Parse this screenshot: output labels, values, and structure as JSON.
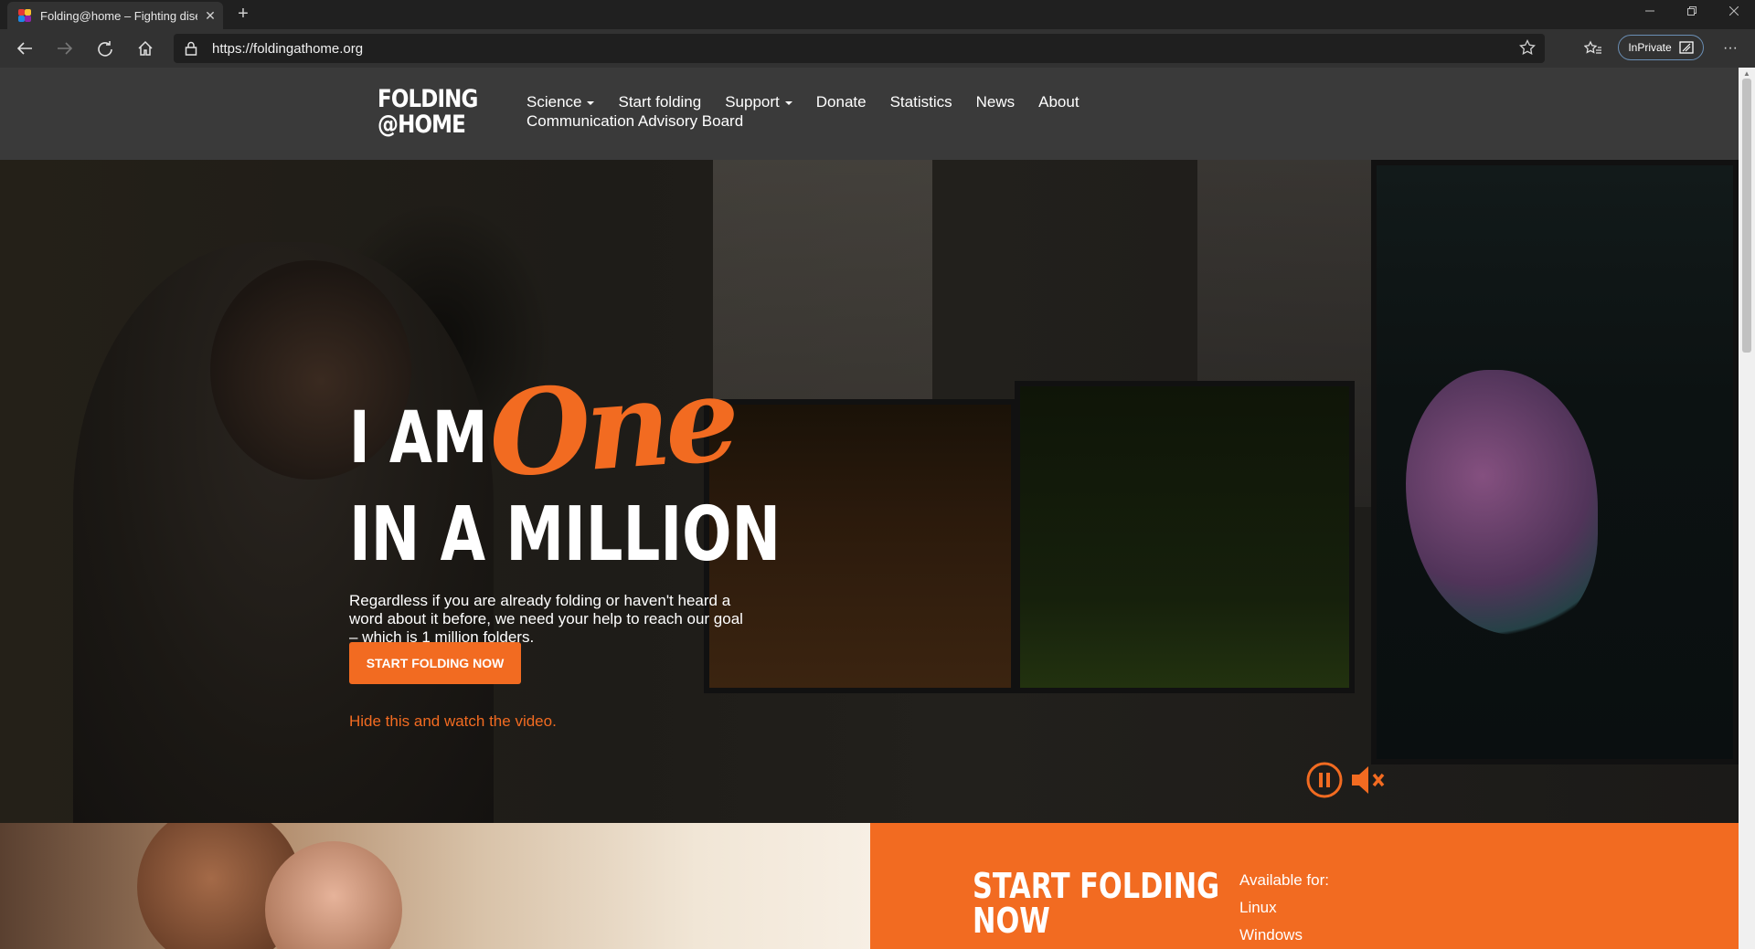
{
  "browser": {
    "tab_title": "Folding@home – Fighting disea",
    "tab_close": "✕",
    "new_tab": "+",
    "url": "https://foldingathome.org",
    "inprivate_label": "InPrivate",
    "menu": "···"
  },
  "site": {
    "logo_line1": "FOLDING",
    "logo_line2": "@HOME",
    "nav": {
      "science": "Science",
      "start_folding": "Start folding",
      "support": "Support",
      "donate": "Donate",
      "statistics": "Statistics",
      "news": "News",
      "about": "About",
      "cab": "Communication Advisory Board"
    }
  },
  "hero": {
    "headline_1": "I AM",
    "headline_script": "One",
    "headline_2": "IN A MILLION",
    "copy": "Regardless if you are already folding or haven't heard a word about it before, we need your help to reach our goal – which is 1 million folders.",
    "cta": "START FOLDING NOW",
    "video_link": "Hide this and watch the video."
  },
  "start_folding": {
    "title_line1": "START FOLDING",
    "title_line2": "NOW",
    "available_label": "Available for:",
    "platforms": [
      "Linux",
      "Windows"
    ]
  },
  "colors": {
    "accent": "#f26b21",
    "header_bg": "#3a3a3a",
    "chrome_bg": "#202020"
  }
}
